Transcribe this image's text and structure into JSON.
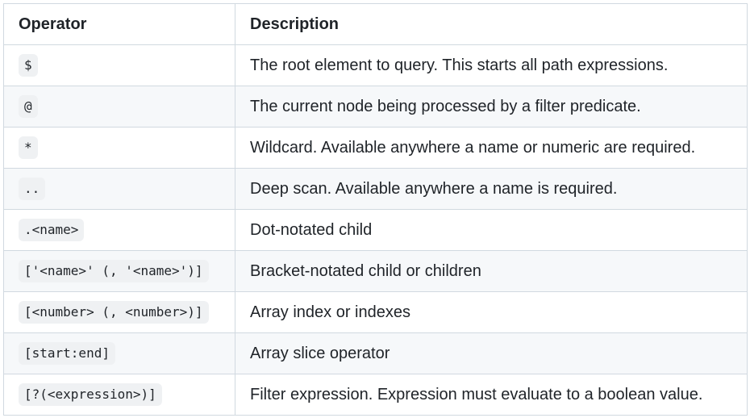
{
  "table": {
    "headers": {
      "operator": "Operator",
      "description": "Description"
    },
    "rows": [
      {
        "operator": "$",
        "description": "The root element to query. This starts all path expressions."
      },
      {
        "operator": "@",
        "description": "The current node being processed by a filter predicate."
      },
      {
        "operator": "*",
        "description": "Wildcard. Available anywhere a name or numeric are required."
      },
      {
        "operator": "..",
        "description": "Deep scan. Available anywhere a name is required."
      },
      {
        "operator": ".<name>",
        "description": "Dot-notated child"
      },
      {
        "operator": "['<name>' (, '<name>')]",
        "description": "Bracket-notated child or children"
      },
      {
        "operator": "[<number> (, <number>)]",
        "description": "Array index or indexes"
      },
      {
        "operator": "[start:end]",
        "description": "Array slice operator"
      },
      {
        "operator": "[?(<expression>)]",
        "description": "Filter expression. Expression must evaluate to a boolean value."
      }
    ]
  }
}
